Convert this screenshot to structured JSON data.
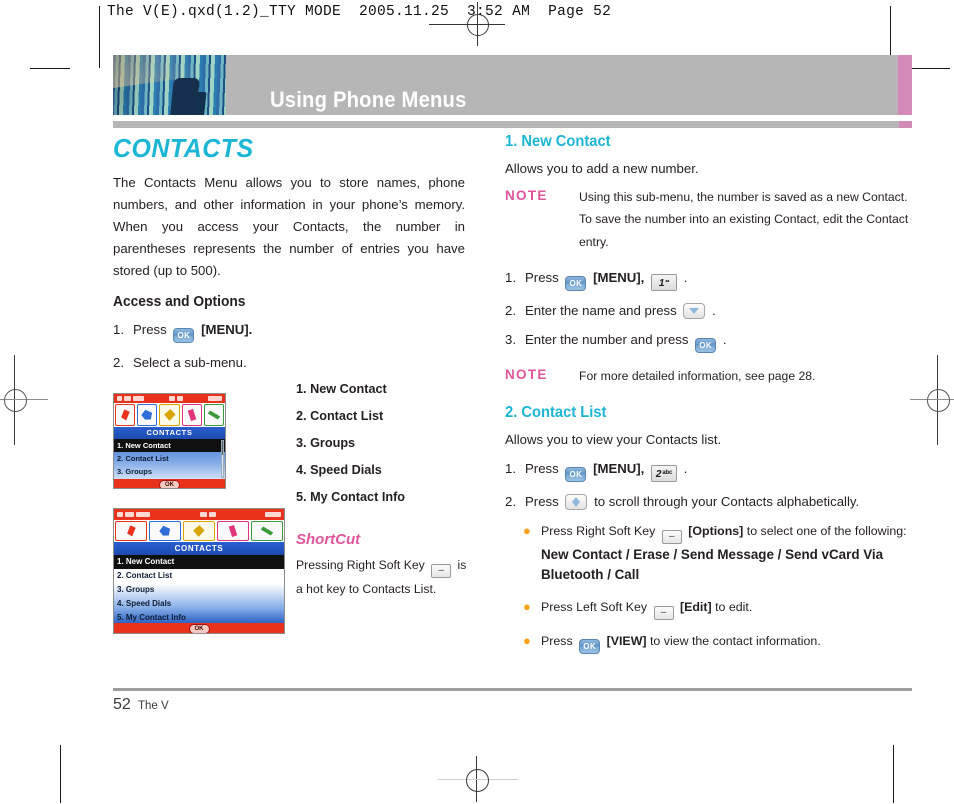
{
  "print_slug": "The V(E).qxd(1.2)_TTY MODE  2005.11.25  3:52 AM  Page 52",
  "header": {
    "title": "Using Phone Menus",
    "accent_color": "#d48ab8",
    "bar_color": "#b6b6b6"
  },
  "left": {
    "section_title": "CONTACTS",
    "intro": "The Contacts Menu allows you to store names, phone numbers, and other information in your phone’s memory. When you access your Contacts, the number in parentheses represents the number of entries you have stored (up to 500).",
    "subhead": "Access and Options",
    "steps": [
      {
        "num": "1.",
        "pre": "Press",
        "key": "OK",
        "post": "[MENU]."
      },
      {
        "num": "2.",
        "pre": "Select a sub-menu.",
        "key": "",
        "post": ""
      }
    ],
    "menu_items": [
      "1. New Contact",
      "2. Contact List",
      "3. Groups",
      "4. Speed Dials",
      "5. My Contact Info"
    ],
    "shortcut": {
      "title": "ShortCut",
      "line1": "Pressing Right Soft Key",
      "line1_tail": "is",
      "line2": "a hot key to Contacts List."
    },
    "screenshot_1": {
      "title": "CONTACTS",
      "rows": [
        "1. New Contact",
        "2. Contact List",
        "3. Groups"
      ],
      "selected_index": 0,
      "softkey": "OK"
    },
    "screenshot_2": {
      "title": "CONTACTS",
      "rows": [
        "1. New Contact",
        "2. Contact List",
        "3. Groups",
        "4. Speed Dials",
        "5. My Contact Info"
      ],
      "selected_index": 0,
      "softkey": "OK"
    }
  },
  "right": {
    "s1": {
      "heading": "1. New Contact",
      "desc": "Allows you to add a new number.",
      "note_tag": "NOTE",
      "note_body": "Using this sub-menu, the number is saved as a new Contact. To save the number into an existing Contact, edit the Contact entry.",
      "steps": [
        {
          "num": "1.",
          "pre": "Press",
          "key": "OK",
          "mid": "[MENU],",
          "key2": "1",
          "key2_sup": "••",
          "post": "."
        },
        {
          "num": "2.",
          "pre": "Enter the name and press",
          "key": "down",
          "post": "."
        },
        {
          "num": "3.",
          "pre": "Enter the number and press",
          "key": "OK",
          "post": "."
        }
      ],
      "note2_tag": "NOTE",
      "note2_body": "For more detailed information, see page 28."
    },
    "s2": {
      "heading": "2. Contact List",
      "desc": "Allows you to view your Contacts list.",
      "steps": [
        {
          "num": "1.",
          "pre": "Press",
          "key": "OK",
          "mid": "[MENU],",
          "key2": "2",
          "key2_sup": "abc",
          "post": "."
        },
        {
          "num": "2.",
          "pre": "Press",
          "key": "updown",
          "post": "to scroll through your Contacts alphabetically."
        }
      ],
      "bullets": [
        {
          "lead": "Press Right Soft Key",
          "key": "softkey",
          "label": "[Options]",
          "tail": "to select one of the following:",
          "options": "New Contact / Erase / Send Message / Send vCard Via Bluetooth / Call"
        },
        {
          "lead": "Press Left Soft Key",
          "key": "softkey",
          "label": "[Edit]",
          "tail": "to edit.",
          "options": ""
        },
        {
          "lead": "Press",
          "key": "OK",
          "label": "[VIEW]",
          "tail": "to view the contact information.",
          "options": ""
        }
      ]
    }
  },
  "footer": {
    "page_number": "52",
    "book_title": "The V"
  }
}
